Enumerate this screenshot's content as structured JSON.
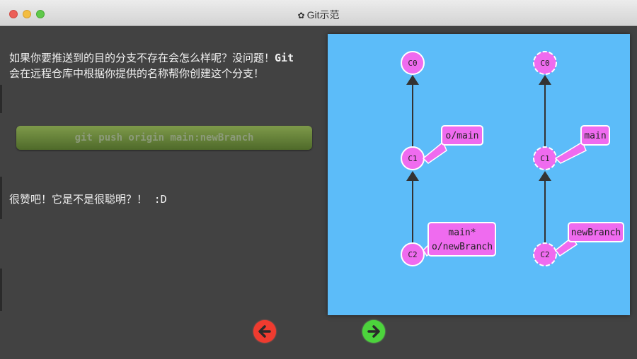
{
  "window": {
    "title": "Git示范",
    "title_icon": "gear-icon"
  },
  "dialog": {
    "para1_text": "如果你要推送到的目的分支不存在会怎么样呢？没问题！",
    "para1_bold": "Git",
    "para1_tail": "会在远程仓库中根据你提供的名称帮你创建这个分支！",
    "command": "git push origin main:newBranch",
    "para2_text": "很赞吧！它是不是很聪明？！",
    "para2_mono": ":D"
  },
  "visualization": {
    "local": {
      "commits": [
        "C0",
        "C1",
        "C2"
      ],
      "branch_labels": [
        "o/main",
        "main*",
        "o/newBranch"
      ]
    },
    "remote": {
      "commits": [
        "C0",
        "C1",
        "C2"
      ],
      "branch_labels": [
        "main",
        "newBranch"
      ]
    },
    "colors": {
      "background": "#5cbcf9",
      "commit": "#ef6bef",
      "label": "#ef6bef"
    }
  },
  "nav": {
    "back_icon": "arrow-left-icon",
    "forward_icon": "arrow-right-icon"
  }
}
